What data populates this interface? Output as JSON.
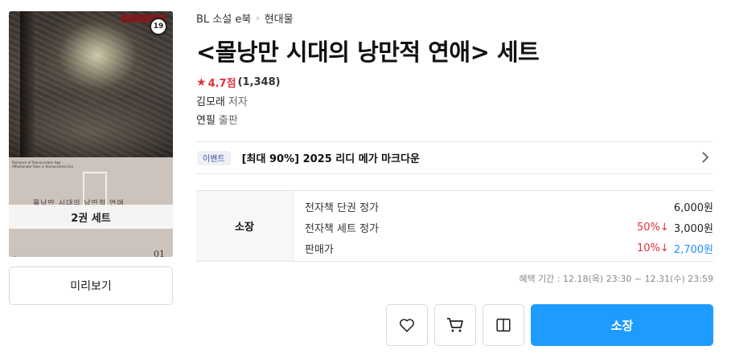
{
  "cover": {
    "age_badge": "19",
    "set_label": "2권 세트",
    "english_title": "Romance of Romanceless Age : Affectionate Tales in Romanceless Era",
    "faint_title": "몰낭만 시대의 낭만적 연애",
    "volume_mark": "01"
  },
  "preview_button": "미리보기",
  "breadcrumb": [
    "BL 소설 e북",
    "현대물"
  ],
  "title": "<몰낭만 시대의 낭만적 연애> 세트",
  "rating": {
    "score": "4.7점",
    "count": "(1,348)"
  },
  "author": {
    "name": "김모래",
    "role": "저자"
  },
  "publisher": {
    "name": "연필",
    "role": "출판"
  },
  "event": {
    "tag": "이벤트",
    "text": "[최대 90%] 2025 리디 메가 마크다운"
  },
  "price": {
    "section_label": "소장",
    "rows": [
      {
        "label": "전자책 단권 정가",
        "discount": "",
        "amount": "6,000원"
      },
      {
        "label": "전자책 세트 정가",
        "discount": "50%↓",
        "amount": "3,000원"
      },
      {
        "label": "판매가",
        "discount": "10%↓",
        "amount": "2,700원"
      }
    ]
  },
  "benefit_period": "혜택 기간 : 12.18(목) 23:30 ~ 12.31(수) 23:59",
  "actions": {
    "buy_label": "소장"
  },
  "colors": {
    "accent": "#1e9bff",
    "discount": "#e0313b",
    "star": "#e0313b"
  }
}
